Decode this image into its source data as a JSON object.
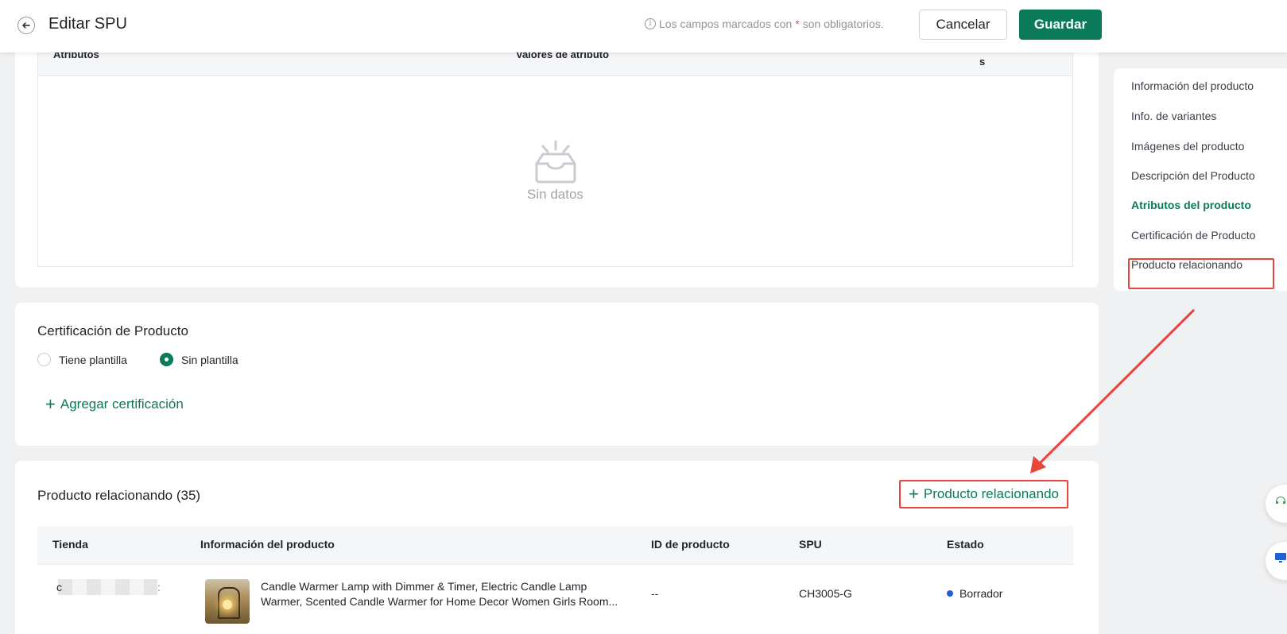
{
  "header": {
    "title": "Editar SPU",
    "hint_prefix": "Los campos marcados con",
    "hint_star": "*",
    "hint_suffix": "son obligatorios.",
    "cancel_label": "Cancelar",
    "save_label": "Guardar"
  },
  "attributes": {
    "col_attributes": "Atributos",
    "col_values": "Valores de atributo",
    "col_extra": "s",
    "empty_text": "Sin datos"
  },
  "certification": {
    "title": "Certificación de Producto",
    "radio_with_template": "Tiene plantilla",
    "radio_without_template": "Sin plantilla",
    "selected": "Sin plantilla",
    "add_label": "Agregar certificación"
  },
  "related": {
    "title": "Producto relacionando (35)",
    "add_label": "Producto relacionando",
    "columns": {
      "store": "Tienda",
      "info": "Información del producto",
      "product_id": "ID de producto",
      "spu": "SPU",
      "status": "Estado"
    },
    "rows": [
      {
        "store_prefix": "c",
        "store_suffix": ":",
        "info_line1": "Candle Warmer Lamp with Dimmer & Timer, Electric Candle Lamp",
        "info_line2": "Warmer, Scented Candle Warmer for Home Decor Women Girls Room...",
        "product_id": "--",
        "spu": "CH3005-G",
        "status": "Borrador",
        "status_color": "#1f5fd8"
      }
    ]
  },
  "anchor_nav": {
    "items": [
      "Información del producto",
      "Info. de variantes",
      "Imágenes del producto",
      "Descripción del Producto",
      "Atributos del producto",
      "Certificación de Producto",
      "Producto relacionando"
    ],
    "active": "Atributos del producto"
  },
  "colors": {
    "primary": "#0b7a5b",
    "annotation": "#e8453c",
    "required": "#e34d59"
  }
}
